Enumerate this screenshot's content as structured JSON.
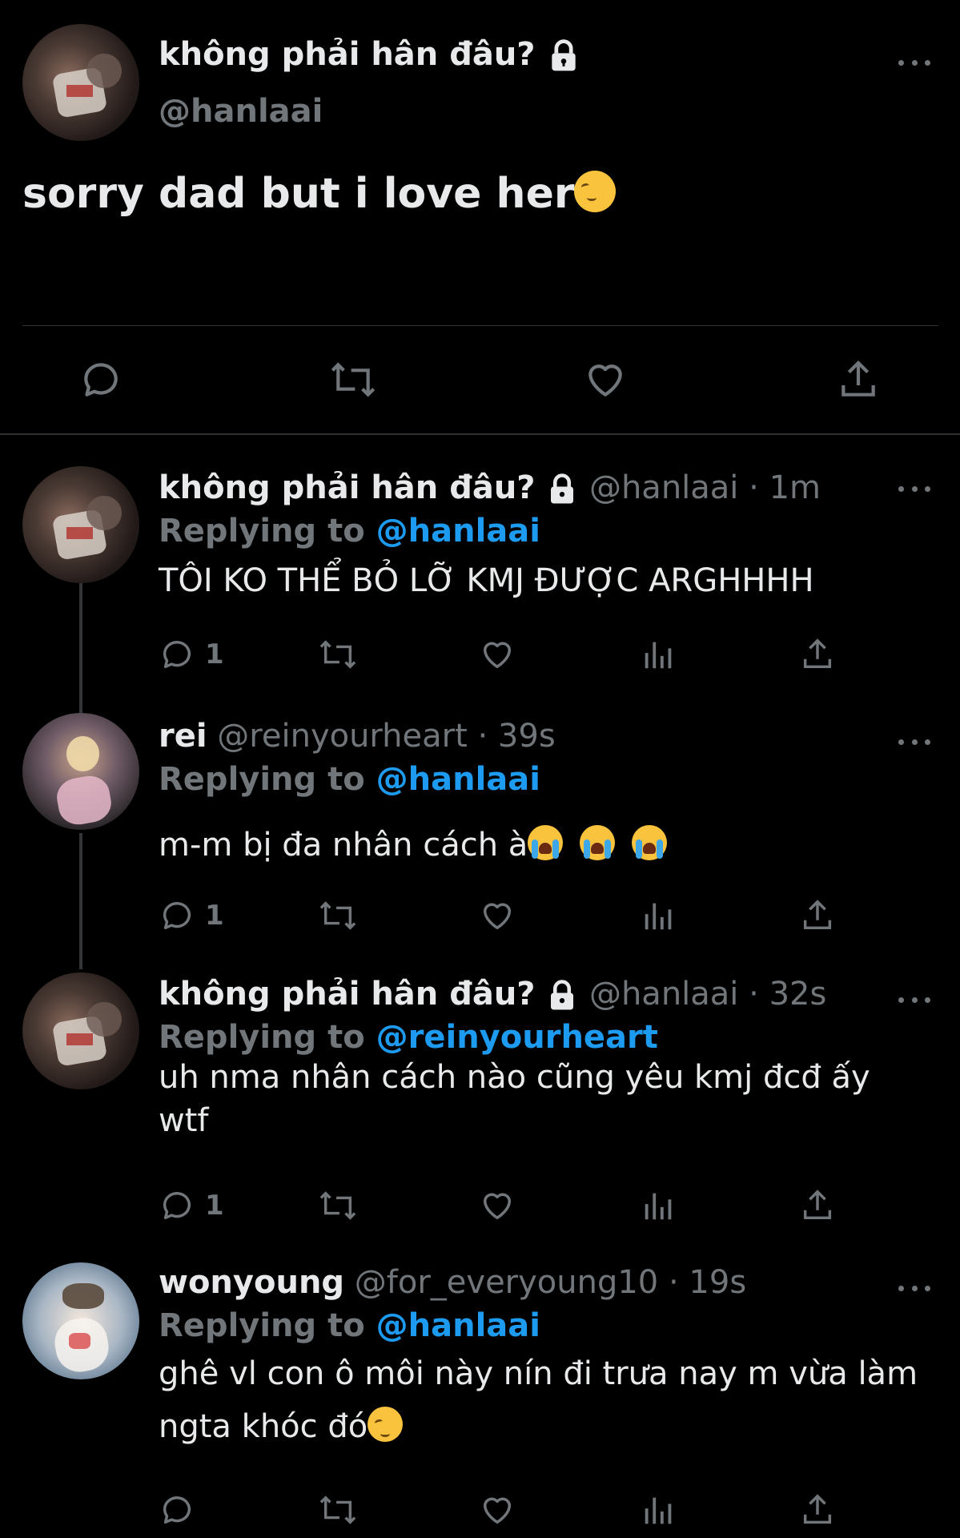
{
  "main_tweet": {
    "author_name": "không phải hân đâu?",
    "author_handle": "@hanlaai",
    "text": "sorry dad but i love her",
    "icons": [
      "reply-icon",
      "retweet-icon",
      "like-icon",
      "share-icon"
    ]
  },
  "replies": [
    {
      "author_name": "không phải hân đâu?",
      "locked": true,
      "handle": "@hanlaai",
      "time": "· 1m",
      "replying_label": "Replying to",
      "replying_to": "@hanlaai",
      "text": "TÔI KO THỂ BỎ LỠ KMJ ĐƯỢC ARGHHHH",
      "reply_count": "1"
    },
    {
      "author_name": "rei",
      "locked": false,
      "handle": "@reinyourheart",
      "time": "· 39s",
      "replying_label": "Replying to",
      "replying_to": "@hanlaai",
      "text": "m-m bị đa nhân cách à",
      "reply_count": "1"
    },
    {
      "author_name": "không phải hân đâu?",
      "locked": true,
      "handle": "@hanlaai",
      "time": "· 32s",
      "replying_label": "Replying to",
      "replying_to": "@reinyourheart",
      "text": "uh nma nhân cách nào cũng yêu kmj đcđ ấy wtf",
      "reply_count": "1"
    },
    {
      "author_name": "wonyoung",
      "locked": false,
      "handle": "@for_everyoung10",
      "time": "· 19s",
      "replying_label": "Replying to",
      "replying_to": "@hanlaai",
      "text": "ghê vl con ô môi này nín đi trưa nay m vừa làm ngta khóc đó",
      "reply_count": ""
    }
  ],
  "colors": {
    "background": "#000000",
    "text": "#e7e9ea",
    "muted": "#71767b",
    "link": "#1d9bf0",
    "divider": "#2f3336"
  }
}
